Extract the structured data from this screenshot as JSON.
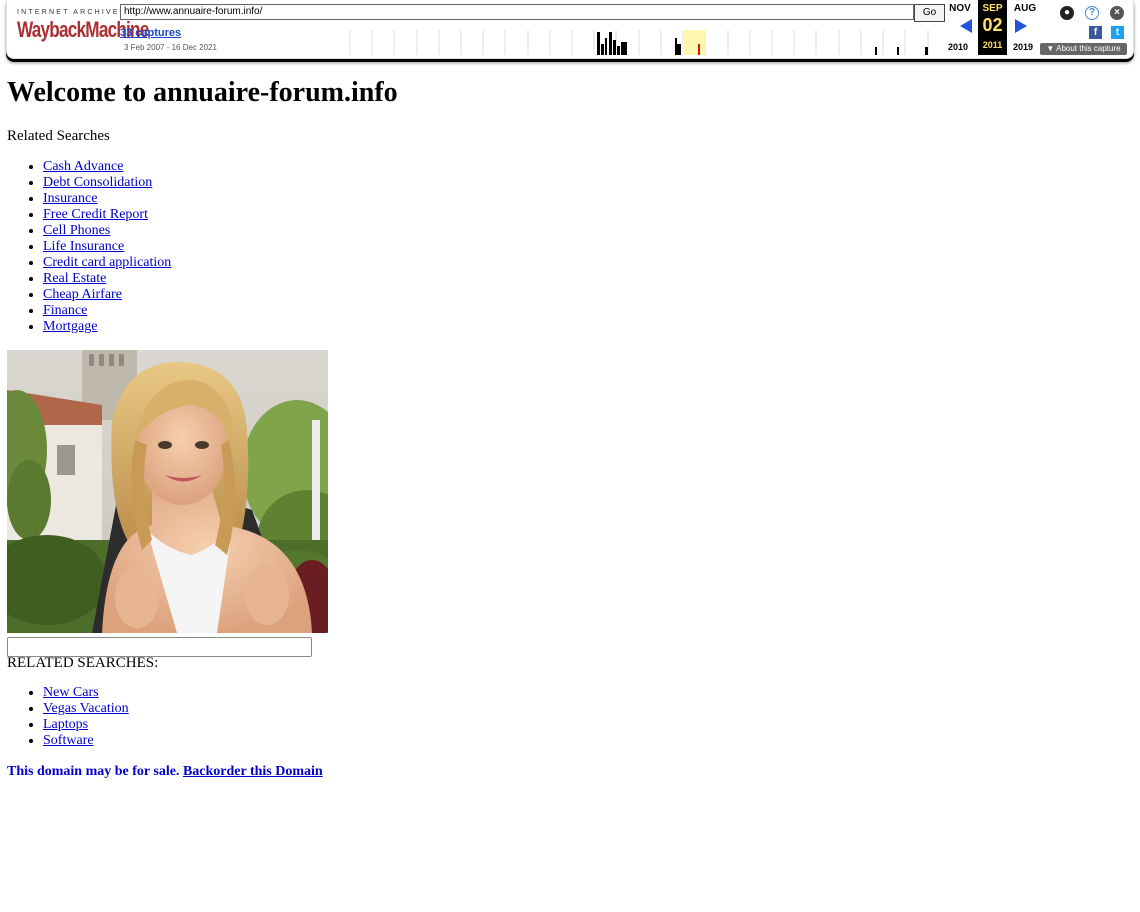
{
  "wayback": {
    "logo_top": "INTERNET ARCHIVE",
    "logo_main": "WaybackMachine",
    "url": "http://www.annuaire-forum.info/",
    "go_label": "Go",
    "captures_label": "33 captures",
    "date_range": "3 Feb 2007 - 16 Dec 2021",
    "prev_month": "NOV",
    "current_month": "SEP",
    "current_day": "02",
    "next_month": "AUG",
    "prev_year": "2010",
    "current_year": "2011",
    "next_year": "2019",
    "about_label": "▼ About this capture",
    "icons": [
      "user-icon",
      "help-icon",
      "close-icon",
      "facebook-icon",
      "twitter-icon"
    ]
  },
  "page": {
    "title": "Welcome to annuaire-forum.info",
    "related_label": "Related Searches",
    "related_links": [
      "Cash Advance",
      "Debt Consolidation",
      "Insurance",
      "Free Credit Report",
      "Cell Phones",
      "Life Insurance",
      "Credit card application",
      "Real Estate",
      "Cheap Airfare",
      "Finance",
      "Mortgage"
    ],
    "search_value": "",
    "related_label_upper": "RELATED SEARCHES:",
    "related_links_2": [
      "New Cars",
      "Vegas Vacation",
      "Laptops",
      "Software"
    ],
    "sale_text": "This domain may be for sale.",
    "sale_link": "Backorder this Domain"
  },
  "colors": {
    "link": "#0000cc",
    "wayback_red": "#ab2e33",
    "highlight_yellow": "#ffe066",
    "arrow_blue": "#2154d9"
  }
}
